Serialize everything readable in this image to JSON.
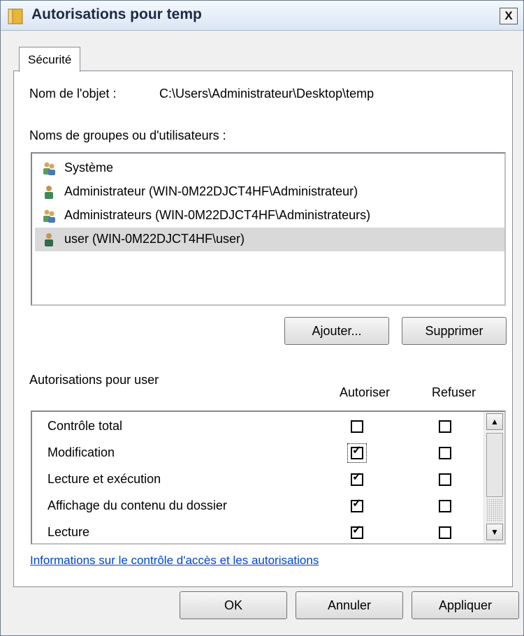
{
  "window": {
    "title": "Autorisations pour temp",
    "close_label": "X"
  },
  "tabs": [
    {
      "label": "Sécurité",
      "active": true
    }
  ],
  "object": {
    "label": "Nom de l'objet :",
    "value": "C:\\Users\\Administrateur\\Desktop\\temp"
  },
  "groups": {
    "label": "Noms de groupes ou d'utilisateurs :",
    "items": [
      {
        "name": "Système",
        "icon": "users-group-icon"
      },
      {
        "name": "Administrateur (WIN-0M22DJCT4HF\\Administrateur)",
        "icon": "user-icon"
      },
      {
        "name": "Administrateurs (WIN-0M22DJCT4HF\\Administrateurs)",
        "icon": "users-group-icon"
      },
      {
        "name": "user (WIN-0M22DJCT4HF\\user)",
        "icon": "user-icon",
        "selected": true
      }
    ]
  },
  "buttons": {
    "add": "Ajouter...",
    "remove": "Supprimer",
    "ok": "OK",
    "cancel": "Annuler",
    "apply": "Appliquer"
  },
  "permissions": {
    "label": "Autorisations pour user",
    "col_allow": "Autoriser",
    "col_deny": "Refuser",
    "rows": [
      {
        "name": "Contrôle total",
        "allow": false,
        "deny": false
      },
      {
        "name": "Modification",
        "allow": true,
        "deny": false,
        "focused": true
      },
      {
        "name": "Lecture et exécution",
        "allow": true,
        "deny": false
      },
      {
        "name": "Affichage du contenu du dossier",
        "allow": true,
        "deny": false
      },
      {
        "name": "Lecture",
        "allow": true,
        "deny": false
      }
    ]
  },
  "link": {
    "text": "Informations sur le contrôle d'accès et les autorisations"
  },
  "colors": {
    "selection": "#d9d9d9",
    "link": "#0044cc",
    "dialog_bg": "#f0f0f0"
  }
}
